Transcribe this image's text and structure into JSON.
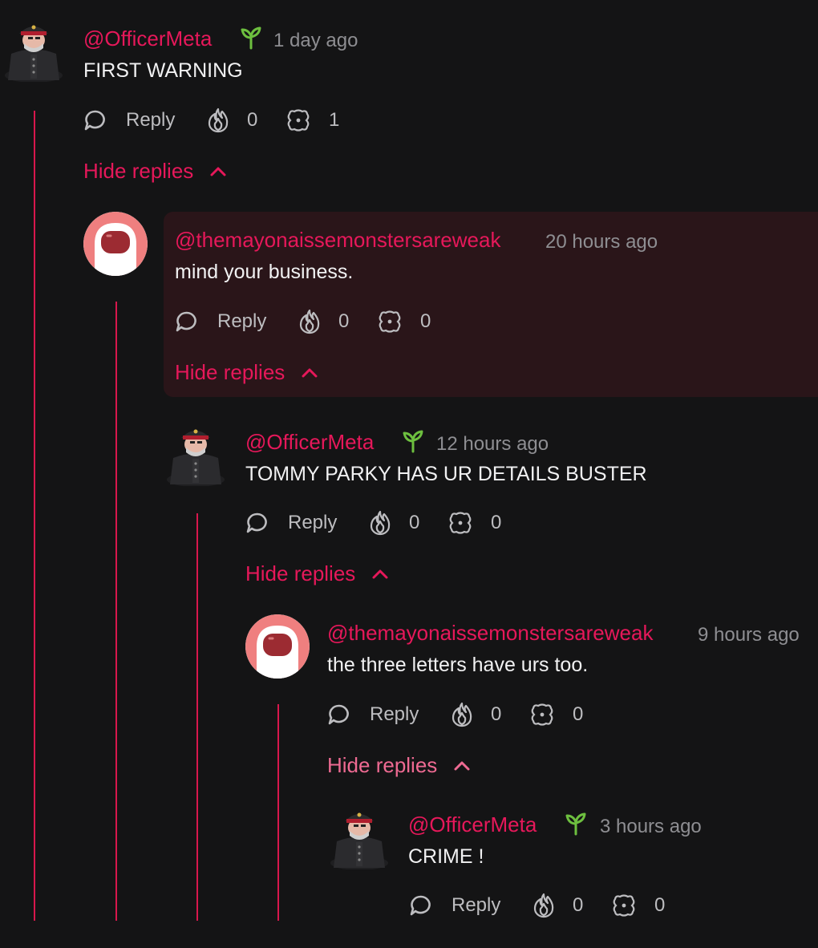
{
  "comments": [
    {
      "username": "@OfficerMeta",
      "time": "1 day ago",
      "text": "FIRST WARNING",
      "reply_label": "Reply",
      "likes": "0",
      "reactions": "1",
      "hide_label": "Hide replies"
    },
    {
      "username": "@themayonaissemonstersareweak",
      "time": "20 hours ago",
      "text": "mind your business.",
      "reply_label": "Reply",
      "likes": "0",
      "reactions": "0",
      "hide_label": "Hide replies"
    },
    {
      "username": "@OfficerMeta",
      "time": "12 hours ago",
      "text": "TOMMY PARKY HAS UR DETAILS BUSTER",
      "reply_label": "Reply",
      "likes": "0",
      "reactions": "0",
      "hide_label": "Hide replies"
    },
    {
      "username": "@themayonaissemonstersareweak",
      "time": "9 hours ago",
      "text": "the three letters have urs too.",
      "reply_label": "Reply",
      "likes": "0",
      "reactions": "0",
      "hide_label": "Hide replies"
    },
    {
      "username": "@OfficerMeta",
      "time": "3 hours ago",
      "text": "CRIME !",
      "reply_label": "Reply",
      "likes": "0",
      "reactions": "0"
    }
  ],
  "icons": {
    "reply": "speech-bubble-icon",
    "like": "flame-icon",
    "reaction": "splat-icon",
    "badge": "sprout-icon",
    "collapse": "chevron-up-icon"
  },
  "colors": {
    "accent": "#e6185a",
    "thread_line": "#d8174c",
    "badge": "#6dbf3f",
    "background": "#141415",
    "highlight": "#2a1519"
  }
}
